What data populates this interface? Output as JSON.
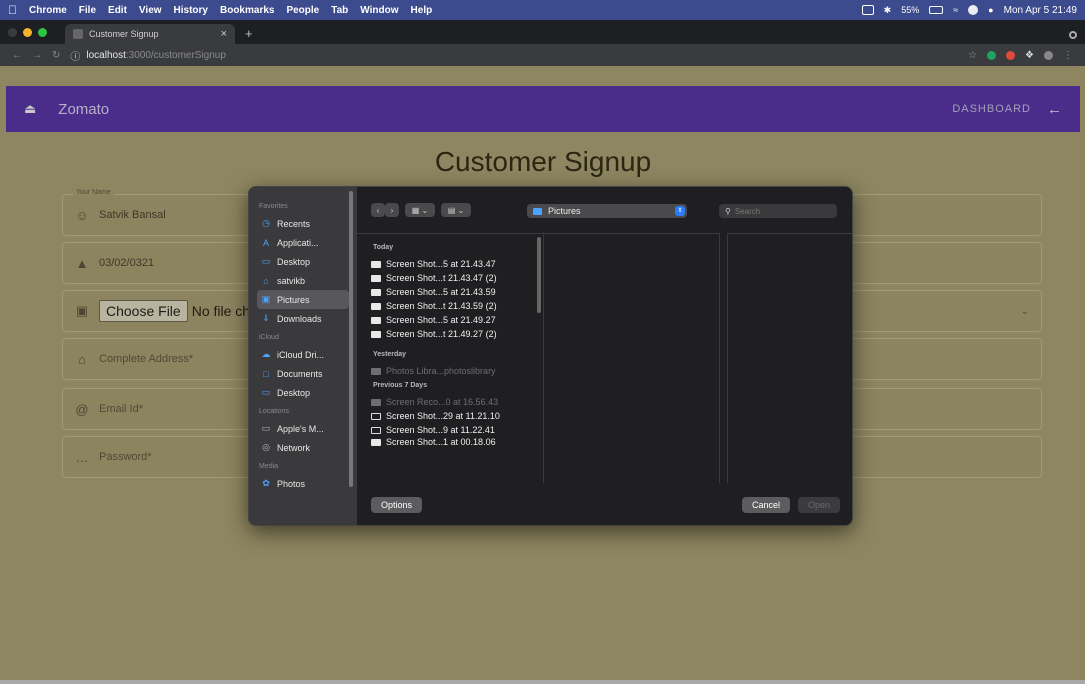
{
  "menubar": {
    "apple": "",
    "items": [
      "Chrome",
      "File",
      "Edit",
      "View",
      "History",
      "Bookmarks",
      "People",
      "Tab",
      "Window",
      "Help"
    ],
    "battery": "55%",
    "datetime": "Mon Apr 5  21:49"
  },
  "browser": {
    "tab_title": "Customer Signup",
    "tab_close": "×",
    "new_tab": "+",
    "url_host": "localhost",
    "url_rest": ":3000/customerSignup"
  },
  "appbar": {
    "brand": "Zomato",
    "dashboard": "DASHBOARD",
    "back": "←"
  },
  "form": {
    "title": "Customer Signup",
    "name_legend": "Your Name",
    "name_value": "Satvik Bansal",
    "dob_value": "03/02/0321",
    "choose_file": "Choose File",
    "no_file": "No file ch",
    "address_ph": "Complete Address*",
    "email_ph": "Email Id*",
    "password_ph": "Password*"
  },
  "dialog": {
    "sidebar": {
      "favorites_label": "Favorites",
      "favorites": [
        "Recents",
        "Applicati...",
        "Desktop",
        "satvikb",
        "Pictures",
        "Downloads"
      ],
      "icloud_label": "iCloud",
      "icloud": [
        "iCloud Dri...",
        "Documents",
        "Desktop"
      ],
      "locations_label": "Locations",
      "locations": [
        "Apple's M...",
        "Network"
      ],
      "media_label": "Media",
      "media": [
        "Photos"
      ]
    },
    "folder": "Pictures",
    "search_placeholder": "Search",
    "groups": {
      "today": "Today",
      "yesterday": "Yesterday",
      "prev7": "Previous 7 Days"
    },
    "today_files": [
      "Screen Shot...5 at 21.43.47",
      "Screen Shot...t 21.43.47 (2)",
      "Screen Shot...5 at 21.43.59",
      "Screen Shot...t 21.43.59 (2)",
      "Screen Shot...5 at 21.49.27",
      "Screen Shot...t 21.49.27 (2)"
    ],
    "yesterday_files": [
      "Photos Libra...photoslibrary"
    ],
    "prev7_files": [
      "Screen Reco...0 at 16.56.43",
      "Screen Shot...29 at 11.21.10",
      "Screen Shot...9 at 11.22.41",
      "Screen Shot...1 at 00.18.06"
    ],
    "options": "Options",
    "cancel": "Cancel",
    "open": "Open"
  }
}
